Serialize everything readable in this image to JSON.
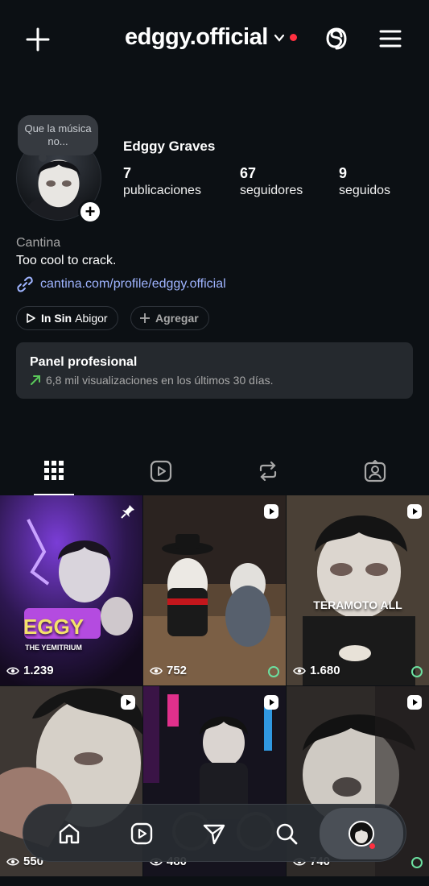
{
  "header": {
    "username": "edggy.official",
    "icons": [
      "plus-icon",
      "chevron-down-icon",
      "threads-icon",
      "menu-icon"
    ],
    "notification_color": "#ff3040"
  },
  "profile": {
    "note": "Que la música no...",
    "display_name": "Edggy Graves",
    "stats": [
      {
        "value": "7",
        "label": "publicaciones"
      },
      {
        "value": "67",
        "label": "seguidores"
      },
      {
        "value": "9",
        "label": "seguidos"
      }
    ],
    "category": "Cantina",
    "bio": "Too cool to crack.",
    "link": "cantina.com/profile/edggy.official",
    "link_color": "#9fb4ff"
  },
  "chips": {
    "music_bold": "In Sin",
    "music_rest": "Abigor",
    "add_label": "Agregar"
  },
  "panel": {
    "title": "Panel profesional",
    "subtitle": "6,8 mil visualizaciones en los últimos 30 días.",
    "trend_color": "#5ac85a"
  },
  "tabs": [
    "grid-icon",
    "reels-icon",
    "reposts-icon",
    "tagged-icon"
  ],
  "posts": [
    {
      "views": "1.239",
      "type": "pinned",
      "overlay": "EGGY",
      "overlay_sub": "THE YEMITRIUM"
    },
    {
      "views": "752",
      "type": "reel"
    },
    {
      "views": "1.680",
      "type": "reel",
      "overlay": "TERAMOTO ALL"
    },
    {
      "views": "550",
      "type": "reel"
    },
    {
      "views": "480",
      "type": "reel"
    },
    {
      "views": "740",
      "type": "reel"
    }
  ],
  "bottom_nav": [
    "home-icon",
    "reels-icon",
    "direct-icon",
    "search-icon",
    "profile-avatar"
  ]
}
